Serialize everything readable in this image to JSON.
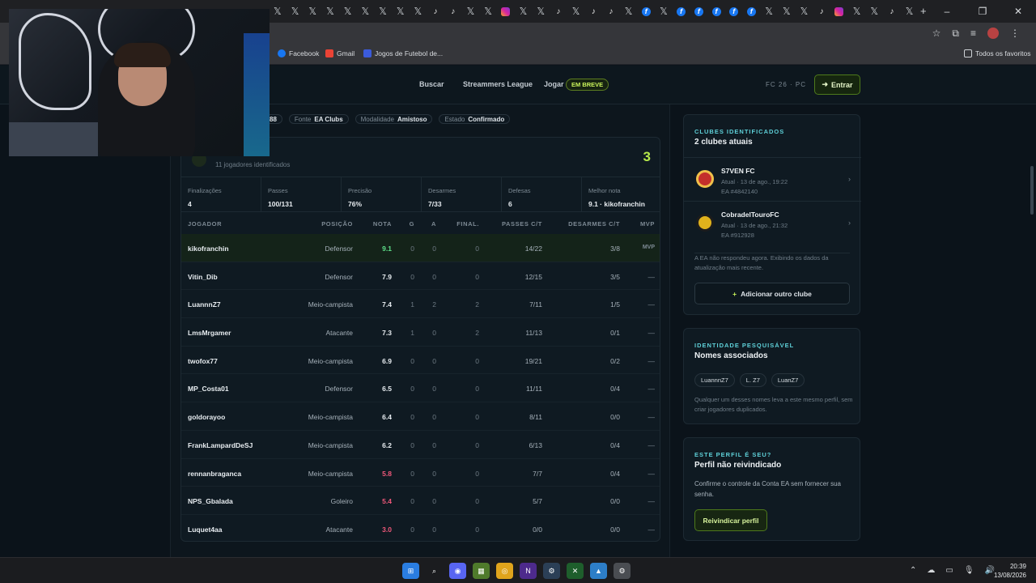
{
  "browser": {
    "tab_icons": [
      "x",
      "x",
      "x",
      "x",
      "x",
      "x",
      "x",
      "x",
      "x",
      "tt",
      "tt",
      "x",
      "x",
      "ig",
      "x",
      "x",
      "tt",
      "x",
      "tt",
      "tt",
      "x",
      "fb",
      "x",
      "fb",
      "fb",
      "fb",
      "fb",
      "fb",
      "x",
      "x",
      "x",
      "tt",
      "ig",
      "x",
      "x",
      "tt",
      "x"
    ],
    "tab_new": "+",
    "window_controls": [
      "–",
      "❐",
      "✕"
    ],
    "bookmarks": [
      {
        "label": "Facebook",
        "color": "#1877f2"
      },
      {
        "label": "Gmail",
        "color": "#ea4335"
      },
      {
        "label": "Jogos de Futebol de...",
        "color": "#3b5bdb"
      }
    ],
    "all_bookmarks": "Todos os favoritos"
  },
  "nav": {
    "buscar": "Buscar",
    "streamers": "Streammers League",
    "jogar": "Jogar",
    "soon_badge": "EM BREVE",
    "platform": "FC 26 · PC",
    "login": "Entrar"
  },
  "match_meta": [
    {
      "key": "",
      "value": "88"
    },
    {
      "key": "Fonte",
      "value": "EA Clubs"
    },
    {
      "key": "Modalidade",
      "value": "Amistoso"
    },
    {
      "key": "Estado",
      "value": "Confirmado"
    }
  ],
  "team": {
    "subtitle": "11 jogadores identificados",
    "score": "3"
  },
  "stats": [
    {
      "label": "Finalizações",
      "value": "4"
    },
    {
      "label": "Passes",
      "value": "100/131"
    },
    {
      "label": "Precisão",
      "value": "76%"
    },
    {
      "label": "Desarmes",
      "value": "7/33"
    },
    {
      "label": "Defesas",
      "value": "6"
    },
    {
      "label": "Melhor nota",
      "value": "9.1 · kikofranchin"
    }
  ],
  "table_headers": {
    "jogador": "JOGADOR",
    "posicao": "POSIÇÃO",
    "nota": "NOTA",
    "g": "G",
    "a": "A",
    "final": "FINAL.",
    "passes": "PASSES C/T",
    "desarmes": "DESARMES C/T",
    "mvp": "MVP"
  },
  "players": [
    {
      "name": "kikofranchin",
      "pos": "Defensor",
      "nota": "9.1",
      "g": "0",
      "a": "0",
      "fin": "0",
      "passes": "14/22",
      "desarmes": "3/8",
      "mvp": "MVP"
    },
    {
      "name": "Vitin_Dib",
      "pos": "Defensor",
      "nota": "7.9",
      "g": "0",
      "a": "0",
      "fin": "0",
      "passes": "12/15",
      "desarmes": "3/5",
      "mvp": "—"
    },
    {
      "name": "LuannnZ7",
      "pos": "Meio-campista",
      "nota": "7.4",
      "g": "1",
      "a": "2",
      "fin": "2",
      "passes": "7/11",
      "desarmes": "1/5",
      "mvp": "—"
    },
    {
      "name": "LmsMrgamer",
      "pos": "Atacante",
      "nota": "7.3",
      "g": "1",
      "a": "0",
      "fin": "2",
      "passes": "11/13",
      "desarmes": "0/1",
      "mvp": "—"
    },
    {
      "name": "twofox77",
      "pos": "Meio-campista",
      "nota": "6.9",
      "g": "0",
      "a": "0",
      "fin": "0",
      "passes": "19/21",
      "desarmes": "0/2",
      "mvp": "—"
    },
    {
      "name": "MP_Costa01",
      "pos": "Defensor",
      "nota": "6.5",
      "g": "0",
      "a": "0",
      "fin": "0",
      "passes": "11/11",
      "desarmes": "0/4",
      "mvp": "—"
    },
    {
      "name": "goldorayoo",
      "pos": "Meio-campista",
      "nota": "6.4",
      "g": "0",
      "a": "0",
      "fin": "0",
      "passes": "8/11",
      "desarmes": "0/0",
      "mvp": "—"
    },
    {
      "name": "FrankLampardDeSJ",
      "pos": "Meio-campista",
      "nota": "6.2",
      "g": "0",
      "a": "0",
      "fin": "0",
      "passes": "6/13",
      "desarmes": "0/4",
      "mvp": "—"
    },
    {
      "name": "rennanbraganca",
      "pos": "Meio-campista",
      "nota": "5.8",
      "g": "0",
      "a": "0",
      "fin": "0",
      "passes": "7/7",
      "desarmes": "0/4",
      "mvp": "—"
    },
    {
      "name": "NPS_Gbalada",
      "pos": "Goleiro",
      "nota": "5.4",
      "g": "0",
      "a": "0",
      "fin": "0",
      "passes": "5/7",
      "desarmes": "0/0",
      "mvp": "—"
    },
    {
      "name": "Luquet4aa",
      "pos": "Atacante",
      "nota": "3.0",
      "g": "0",
      "a": "0",
      "fin": "0",
      "passes": "0/0",
      "desarmes": "0/0",
      "mvp": "—"
    }
  ],
  "rating_colors": {
    "high": "#5fe08a",
    "mid": "#e8edf1",
    "low": "#f0587a"
  },
  "clubs_panel": {
    "kicker": "CLUBES IDENTIFICADOS",
    "title": "2 clubes atuais",
    "clubs": [
      {
        "name": "S7VEN FC",
        "updated": "Atual · 13 de ago., 19:22",
        "ea_id": "EA #4842140",
        "color": "#c4302b"
      },
      {
        "name": "CobradelTouroFC",
        "updated": "Atual · 13 de ago., 21:32",
        "ea_id": "EA #912928",
        "color": "#e0b21c"
      }
    ],
    "note": "A EA não respondeu agora. Exibindo os dados da atualização mais recente.",
    "add_button": "Adicionar outro clube"
  },
  "identity_panel": {
    "kicker": "IDENTIDADE PESQUISÁVEL",
    "title": "Nomes associados",
    "names": [
      "LuannnZ7",
      "L. Z7",
      "LuanZ7"
    ],
    "note": "Qualquer um desses nomes leva a este mesmo perfil, sem criar jogadores duplicados."
  },
  "claim_panel": {
    "kicker": "ESTE PERFIL É SEU?",
    "title": "Perfil não reivindicado",
    "note": "Confirme o controle da Conta EA sem fornecer sua senha.",
    "button": "Reivindicar perfil"
  },
  "taskbar": {
    "icons": [
      {
        "name": "start",
        "color": "#2a7de1",
        "glyph": "⊞"
      },
      {
        "name": "search",
        "color": "transparent",
        "glyph": "⌕"
      },
      {
        "name": "discord",
        "color": "#5865f2",
        "glyph": "◉"
      },
      {
        "name": "minecraft",
        "color": "#4f7a2b",
        "glyph": "▦"
      },
      {
        "name": "chrome",
        "color": "#e0a41c",
        "glyph": "◎"
      },
      {
        "name": "nzxt",
        "color": "#4d2a8c",
        "glyph": "N"
      },
      {
        "name": "steam",
        "color": "#2b3f56",
        "glyph": "⚙"
      },
      {
        "name": "xbox",
        "color": "#1e5e2c",
        "glyph": "✕"
      },
      {
        "name": "photos",
        "color": "#2d7ec8",
        "glyph": "▲"
      },
      {
        "name": "settings",
        "color": "#4a4d52",
        "glyph": "⚙"
      }
    ],
    "time": "20:39",
    "date": "13/08/2026"
  }
}
